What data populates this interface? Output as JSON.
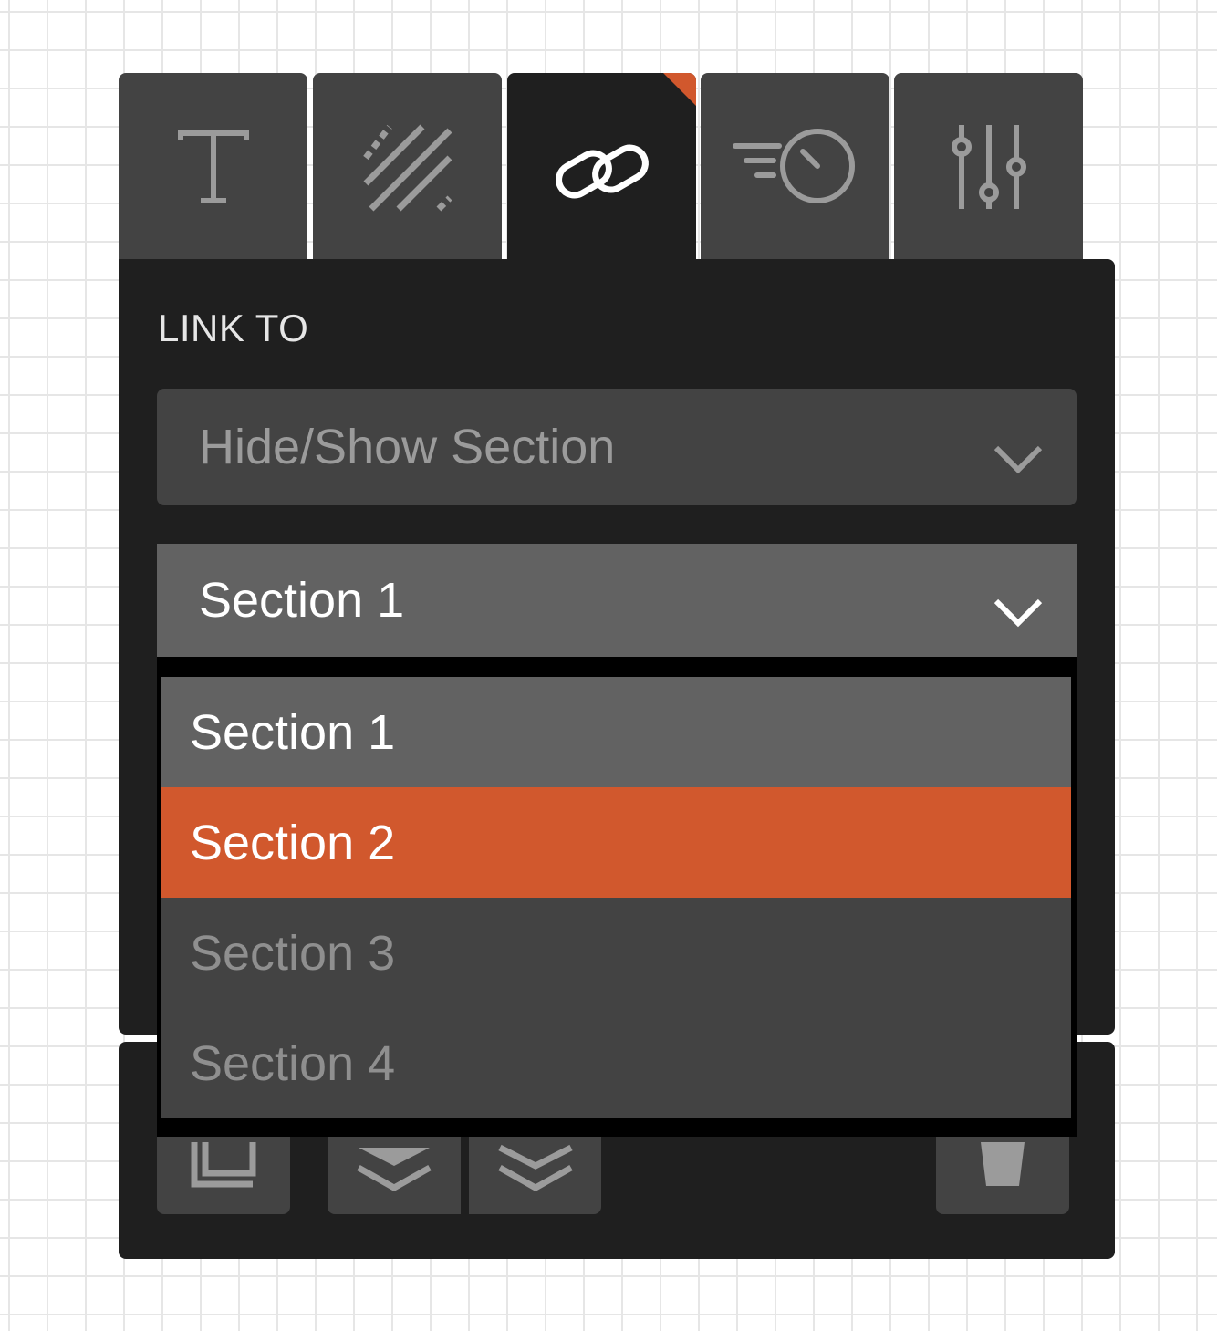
{
  "tabs": [
    {
      "icon": "text-icon",
      "active": false
    },
    {
      "icon": "texture-icon",
      "active": false
    },
    {
      "icon": "link-icon",
      "active": true
    },
    {
      "icon": "animation-timer-icon",
      "active": false
    },
    {
      "icon": "sliders-icon",
      "active": false
    }
  ],
  "link_panel": {
    "label": "LINK TO",
    "link_type_value": "Hide/Show Section",
    "section_value": "Section 1"
  },
  "section_options": [
    {
      "label": "Section 1",
      "state": "selected"
    },
    {
      "label": "Section 2",
      "state": "hovered"
    },
    {
      "label": "Section 3",
      "state": "normal"
    },
    {
      "label": "Section 4",
      "state": "normal"
    }
  ],
  "bottom_toolbar": {
    "buttons": [
      "duplicate-icon",
      "move-to-back-icon",
      "move-backward-icon",
      "delete-icon"
    ]
  },
  "colors": {
    "accent": "#d1582d",
    "panel_bg": "#1f1f1f",
    "control_bg": "#434343",
    "selected_bg": "#626262"
  }
}
